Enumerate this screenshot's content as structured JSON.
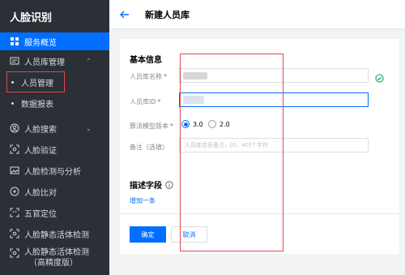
{
  "sidebar": {
    "brand": "人脸识别",
    "items": [
      {
        "label": "服务概览",
        "icon": "grid-icon"
      },
      {
        "label": "人员库管理",
        "icon": "database-icon"
      },
      {
        "label": "人脸搜索",
        "icon": "face-icon"
      },
      {
        "label": "人脸验证",
        "icon": "scan-icon"
      },
      {
        "label": "人脸检测与分析",
        "icon": "image-icon"
      },
      {
        "label": "人脸比对",
        "icon": "compare-icon"
      },
      {
        "label": "五官定位",
        "icon": "locate-icon"
      },
      {
        "label": "人脸静态活体检测",
        "icon": "scan-icon"
      },
      {
        "label": "人脸静态活体检测（高精度版）",
        "icon": "scan-icon"
      }
    ],
    "sub_items": [
      "人员管理",
      "数据报表"
    ],
    "high_precision_line1": "人脸静态活体检测",
    "high_precision_line2": "（高精度版）"
  },
  "header": {
    "title": "新建人员库"
  },
  "form": {
    "basic_title": "基本信息",
    "name_label": "人员库名称",
    "id_label": "人员库ID",
    "algo_label": "算法模型版本",
    "algo_options": [
      "3.0",
      "2.0"
    ],
    "algo_selected": "3.0",
    "remark_label": "备注（选填）",
    "remark_placeholder": "人员库信息备注，[0，40]个字符",
    "required_mark": "*",
    "desc_title": "描述字段",
    "add_link": "增加一条",
    "confirm": "确定",
    "cancel": "取消"
  },
  "colors": {
    "accent": "#006eff",
    "sidebar_bg": "#2b2f36",
    "highlight": "#e0484e",
    "success": "#2ba471"
  }
}
